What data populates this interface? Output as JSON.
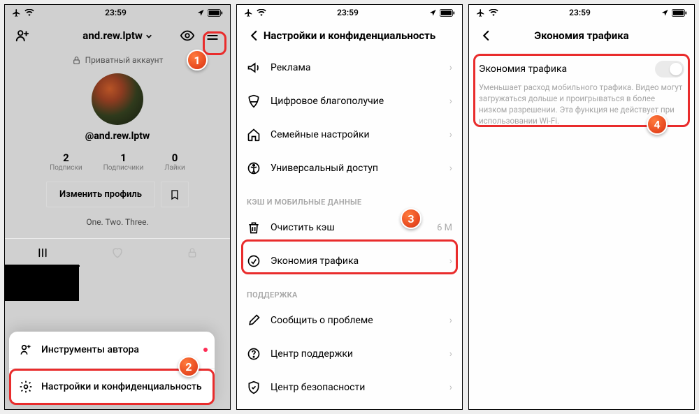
{
  "status": {
    "time": "23:59"
  },
  "p1": {
    "username": "and.rew.lptw",
    "private_label": "Приватный аккаунт",
    "handle": "@and.rew.lptw",
    "stats": [
      {
        "num": "2",
        "label": "Подписки"
      },
      {
        "num": "1",
        "label": "Подписчики"
      },
      {
        "num": "0",
        "label": "Лайки"
      }
    ],
    "edit_label": "Изменить профиль",
    "bio": "One. Two. Three.",
    "sheet": {
      "creator_tools": "Инструменты автора",
      "settings": "Настройки и конфиденциальность"
    }
  },
  "p2": {
    "title": "Настройки и конфиденциальность",
    "items": {
      "ads": "Реклама",
      "wellbeing": "Цифровое благополучие",
      "family": "Семейные настройки",
      "accessibility": "Универсальный доступ"
    },
    "section_cache": "КЭШ И МОБИЛЬНЫЕ ДАННЫЕ",
    "clear_cache": "Очистить кэш",
    "cache_size": "6 M",
    "data_saver": "Экономия трафика",
    "section_support": "ПОДДЕРЖКА",
    "report": "Сообщить о проблеме",
    "help_center": "Центр поддержки",
    "safety_center": "Центр безопасности"
  },
  "p3": {
    "title": "Экономия трафика",
    "row_label": "Экономия трафика",
    "desc": "Уменьшает расход мобильного трафика. Видео могут загружаться дольше и проигрываться в более низком разрешении. Эта функция не действует при использовании Wi-Fi."
  },
  "badges": {
    "b1": "1",
    "b2": "2",
    "b3": "3",
    "b4": "4"
  }
}
